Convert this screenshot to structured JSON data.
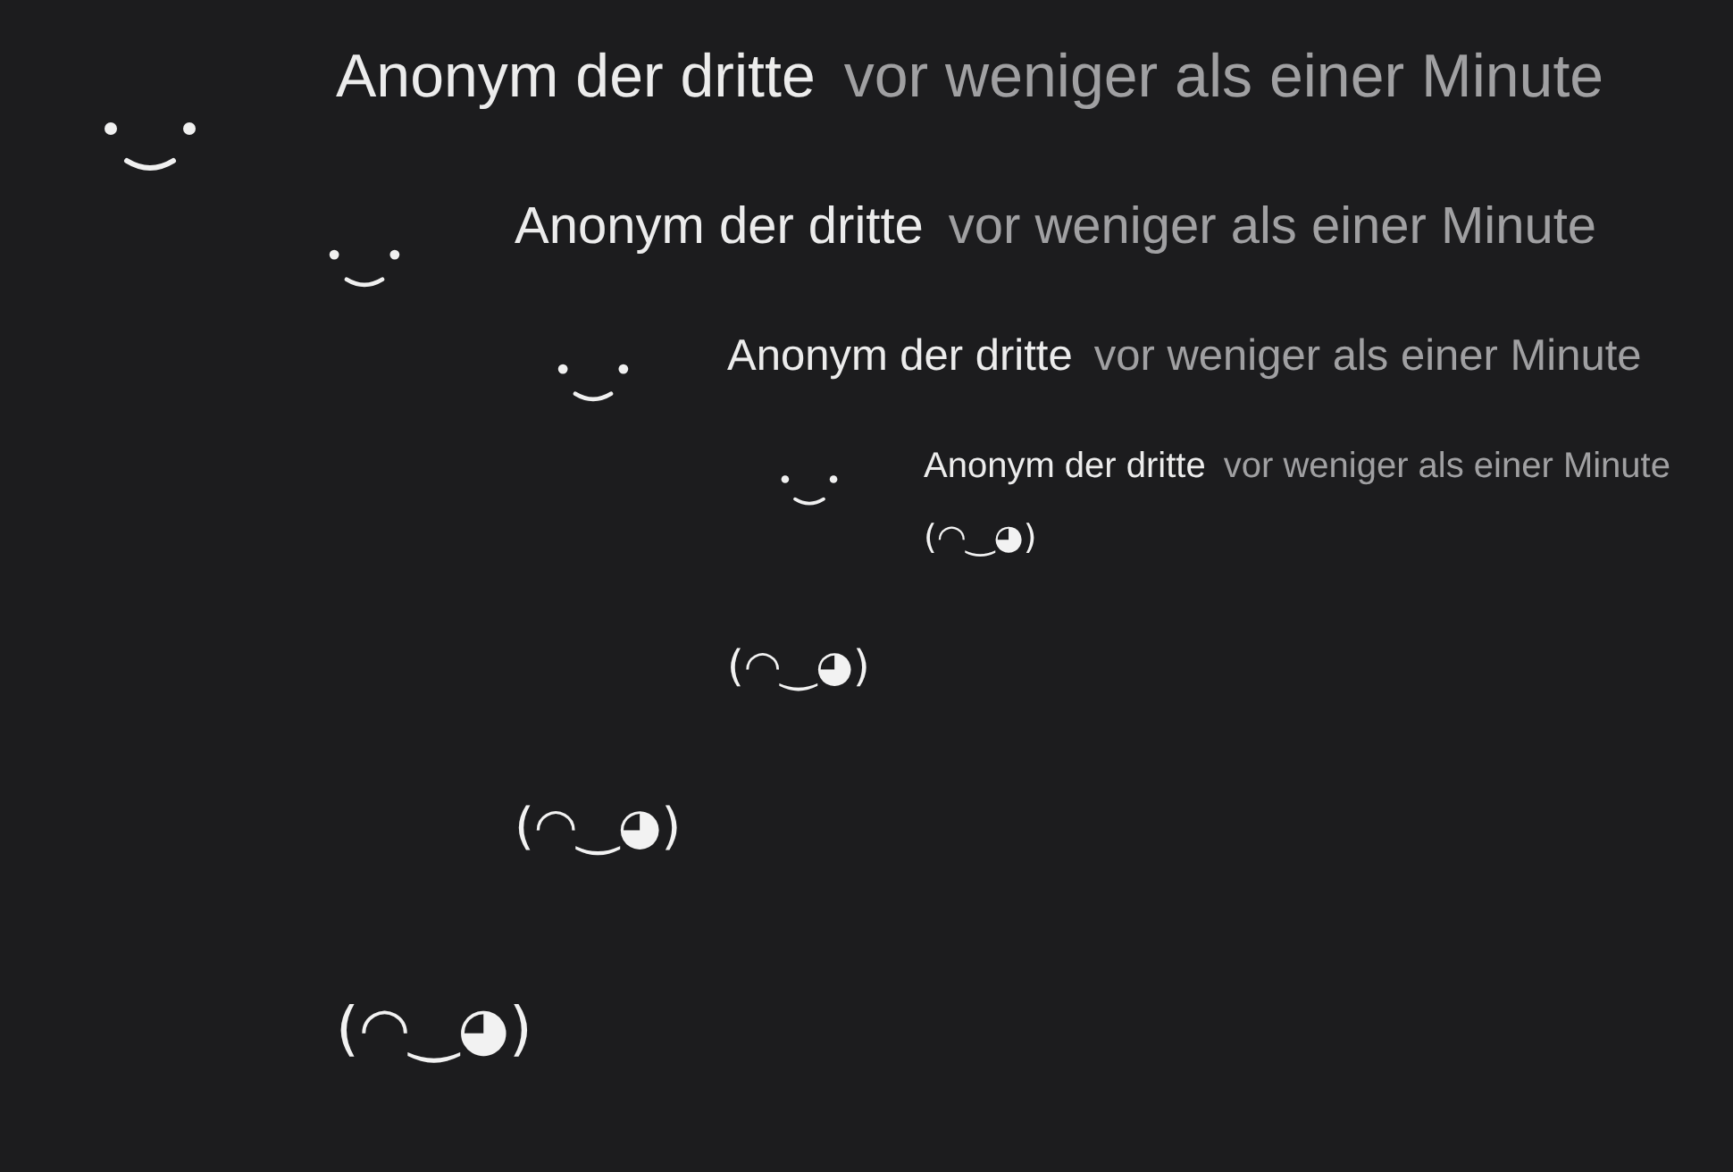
{
  "comments": [
    {
      "author": "Anonym der dritte",
      "time": "vor weniger als einer Minute",
      "body": "(◠‿◕)",
      "replies": [
        {
          "author": "Anonym der dritte",
          "time": "vor weniger als einer Minute",
          "body": "(◠‿◕)",
          "replies": [
            {
              "author": "Anonym der dritte",
              "time": "vor weniger als einer Minute",
              "body": "(◠‿◕)",
              "replies": [
                {
                  "author": "Anonym der dritte",
                  "time": "vor weniger als einer Minute",
                  "body": "(◠‿◕)"
                }
              ]
            }
          ]
        }
      ]
    }
  ]
}
